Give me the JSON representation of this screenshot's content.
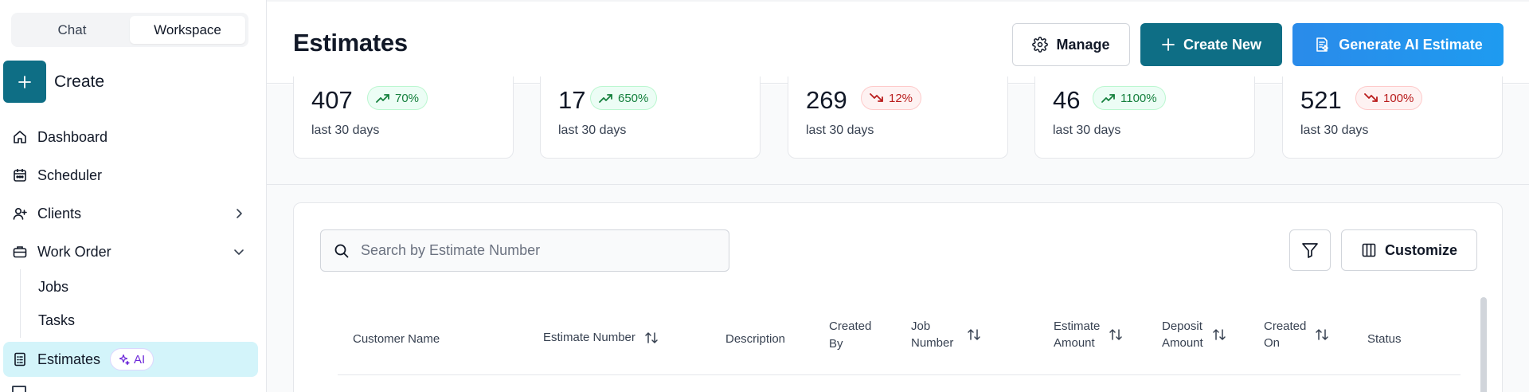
{
  "sidebar": {
    "mode_tabs": [
      {
        "label": "Chat",
        "active": false
      },
      {
        "label": "Workspace",
        "active": true
      }
    ],
    "create_label": "Create",
    "items": [
      {
        "label": "Dashboard",
        "icon": "home-icon"
      },
      {
        "label": "Scheduler",
        "icon": "calendar-icon"
      },
      {
        "label": "Clients",
        "icon": "user-plus-icon",
        "chevron": "right"
      },
      {
        "label": "Work Order",
        "icon": "briefcase-icon",
        "chevron": "down"
      }
    ],
    "sub_items": [
      {
        "label": "Jobs"
      },
      {
        "label": "Tasks"
      }
    ],
    "active_item": {
      "label": "Estimates",
      "icon": "document-icon",
      "badge": "AI"
    }
  },
  "header": {
    "title": "Estimates",
    "manage_label": "Manage",
    "create_new_label": "Create New",
    "generate_ai_label": "Generate AI Estimate"
  },
  "stats": [
    {
      "value": "407",
      "change": "70%",
      "trend": "up",
      "period": "last 30 days"
    },
    {
      "value": "17",
      "change": "650%",
      "trend": "up",
      "period": "last 30 days"
    },
    {
      "value": "269",
      "change": "12%",
      "trend": "down",
      "period": "last 30 days"
    },
    {
      "value": "46",
      "change": "1100%",
      "trend": "up",
      "period": "last 30 days"
    },
    {
      "value": "521",
      "change": "100%",
      "trend": "down",
      "period": "last 30 days"
    }
  ],
  "table": {
    "search_placeholder": "Search by Estimate Number",
    "customize_label": "Customize",
    "columns": [
      {
        "line1": "Customer Name",
        "line2": "",
        "sortable": false
      },
      {
        "line1": "Estimate Number",
        "line2": "",
        "sortable": true
      },
      {
        "line1": "Description",
        "line2": "",
        "sortable": false
      },
      {
        "line1": "Created",
        "line2": "By",
        "sortable": false
      },
      {
        "line1": "Job",
        "line2": "Number",
        "sortable": true
      },
      {
        "line1": "Estimate",
        "line2": "Amount",
        "sortable": true
      },
      {
        "line1": "Deposit",
        "line2": "Amount",
        "sortable": true
      },
      {
        "line1": "Created",
        "line2": "On",
        "sortable": true
      },
      {
        "line1": "Status",
        "line2": "",
        "sortable": false
      }
    ]
  },
  "colors": {
    "primary": "#0e6e85",
    "ai_blue": "#2a8bea",
    "active_bg": "#d3f4fa",
    "up_green": "#15803d",
    "down_red": "#b91c1c"
  }
}
